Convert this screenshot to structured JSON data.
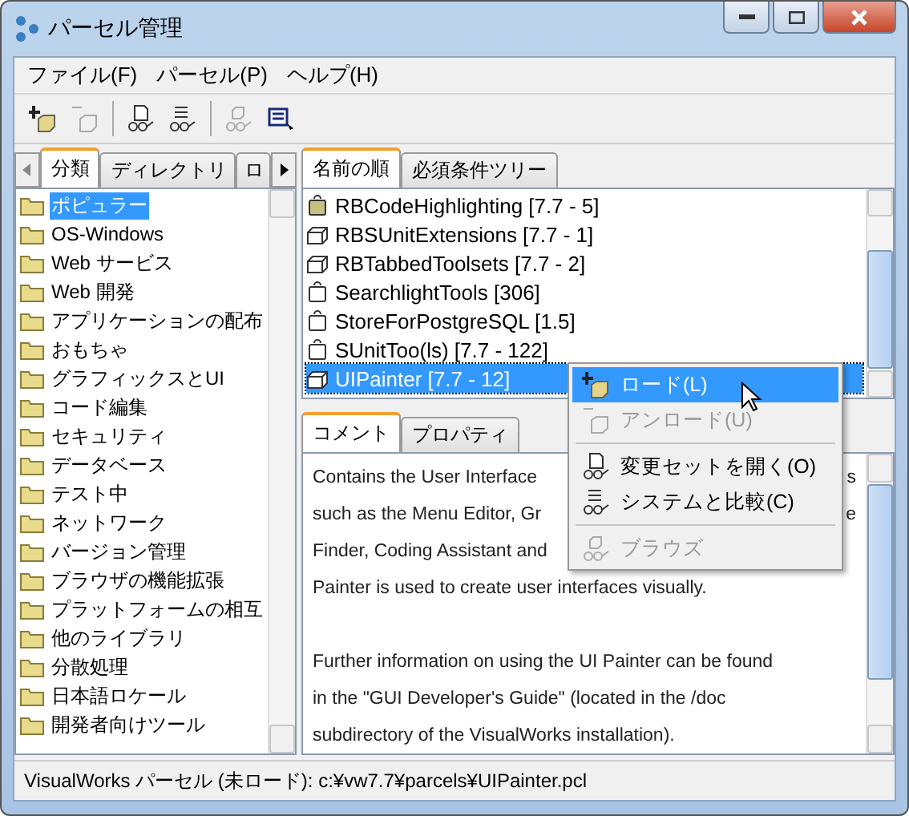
{
  "window": {
    "title": "パーセル管理"
  },
  "menu_bar": [
    "ファイル(F)",
    "パーセル(P)",
    "ヘルプ(H)"
  ],
  "toolbar": [
    {
      "kind": "load",
      "disabled": false
    },
    {
      "kind": "unload",
      "disabled": true
    },
    {
      "kind": "sep"
    },
    {
      "kind": "changeset",
      "disabled": false
    },
    {
      "kind": "compare",
      "disabled": false
    },
    {
      "kind": "sep"
    },
    {
      "kind": "browse",
      "disabled": true
    },
    {
      "kind": "properties",
      "disabled": false
    }
  ],
  "left_tabs": [
    {
      "label": "分類",
      "selected": true
    },
    {
      "label": "ディレクトリ",
      "selected": false
    },
    {
      "label": "ロ",
      "selected": false
    }
  ],
  "categories": [
    {
      "label": "ポピュラー",
      "selected": true
    },
    {
      "label": "OS-Windows",
      "selected": false
    },
    {
      "label": "Web サービス",
      "selected": false
    },
    {
      "label": "Web 開発",
      "selected": false
    },
    {
      "label": "アプリケーションの配布",
      "selected": false
    },
    {
      "label": "おもちゃ",
      "selected": false
    },
    {
      "label": "グラフィックスとUI",
      "selected": false
    },
    {
      "label": "コード編集",
      "selected": false
    },
    {
      "label": "セキュリティ",
      "selected": false
    },
    {
      "label": "データベース",
      "selected": false
    },
    {
      "label": "テスト中",
      "selected": false
    },
    {
      "label": "ネットワーク",
      "selected": false
    },
    {
      "label": "バージョン管理",
      "selected": false
    },
    {
      "label": "ブラウザの機能拡張",
      "selected": false
    },
    {
      "label": "プラットフォームの相互",
      "selected": false
    },
    {
      "label": "他のライブラリ",
      "selected": false
    },
    {
      "label": "分散処理",
      "selected": false
    },
    {
      "label": "日本語ロケール",
      "selected": false
    },
    {
      "label": "開発者向けツール",
      "selected": false
    }
  ],
  "right_tabs": [
    {
      "label": "名前の順",
      "selected": true
    },
    {
      "label": "必須条件ツリー",
      "selected": false
    }
  ],
  "parcels": [
    {
      "label": "RBCodeHighlighting [7.7 - 5]",
      "kind": "bag",
      "selected": false
    },
    {
      "label": "RBSUnitExtensions [7.7 - 1]",
      "kind": "box",
      "selected": false
    },
    {
      "label": "RBTabbedToolsets [7.7 - 2]",
      "kind": "box",
      "selected": false
    },
    {
      "label": "SearchlightTools [306]",
      "kind": "bag-outline",
      "selected": false
    },
    {
      "label": "StoreForPostgreSQL [1.5]",
      "kind": "bag-outline",
      "selected": false
    },
    {
      "label": "SUnitToo(ls) [7.7 - 122]",
      "kind": "bag-outline",
      "selected": false
    },
    {
      "label": "UIPainter [7.7 - 12]",
      "kind": "box",
      "selected": true
    }
  ],
  "detail_tabs": [
    {
      "label": "コメント",
      "selected": true
    },
    {
      "label": "プロパティ",
      "selected": false
    }
  ],
  "comment_paragraphs": [
    [
      {
        "left": "Contains the User Interface",
        "right": "s"
      },
      {
        "left": "such as the Menu Editor, Gr",
        "right": "e"
      },
      {
        "left": "Finder, Coding Assistant and"
      },
      {
        "left": "Painter is used to create user interfaces visually."
      }
    ],
    [
      {
        "left": "Further information on using the UI Painter can be found"
      },
      {
        "left": "in the \"GUI Developer's Guide\" (located in the /doc"
      },
      {
        "left": "subdirectory of the VisualWorks installation)."
      }
    ]
  ],
  "context_menu": [
    {
      "kind": "load",
      "label": "ロード(L)",
      "disabled": false,
      "selected": true
    },
    {
      "kind": "unload",
      "label": "アンロード(U)",
      "disabled": true,
      "selected": false
    },
    {
      "kind": "separator"
    },
    {
      "kind": "changeset",
      "label": "変更セットを開く(O)",
      "disabled": false,
      "selected": false
    },
    {
      "kind": "compare",
      "label": "システムと比較(C)",
      "disabled": false,
      "selected": false
    },
    {
      "kind": "separator"
    },
    {
      "kind": "browse",
      "label": "ブラウズ",
      "disabled": true,
      "selected": false
    }
  ],
  "status_bar": "VisualWorks パーセル (未ロード): c:¥vw7.7¥parcels¥UIPainter.pcl"
}
